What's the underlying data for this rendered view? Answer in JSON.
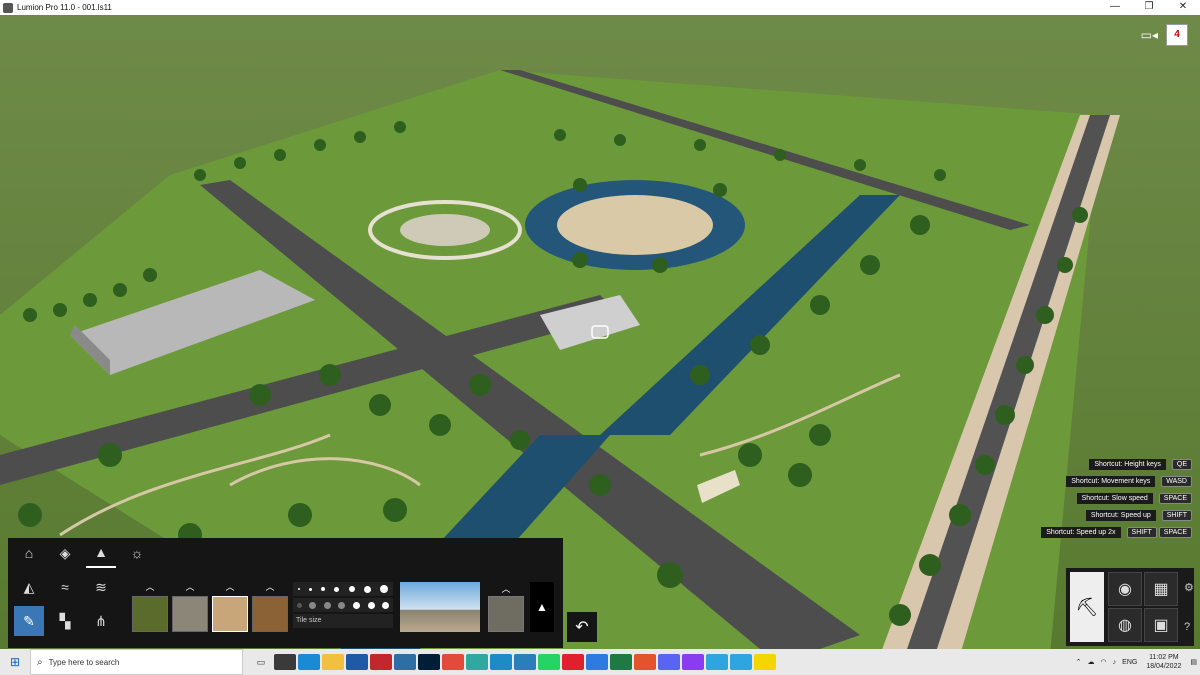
{
  "window": {
    "title": "Lumion Pro 11.0  - 001.ls11",
    "minimize": "—",
    "restore": "❐",
    "close": "✕"
  },
  "viewport": {
    "notification_count": "4",
    "camera_icon": "video-camera-icon"
  },
  "shortcuts": [
    {
      "label": "Shortcut: Height keys",
      "keys": [
        "QE"
      ]
    },
    {
      "label": "Shortcut: Movement keys",
      "keys": [
        "WASD"
      ]
    },
    {
      "label": "Shortcut: Slow speed",
      "keys": [
        "SPACE"
      ]
    },
    {
      "label": "Shortcut: Speed up",
      "keys": [
        "SHIFT"
      ]
    },
    {
      "label": "Shortcut: Speed up 2x",
      "keys": [
        "SHIFT",
        "SPACE"
      ]
    }
  ],
  "landscape_panel": {
    "categories": [
      "home",
      "paint",
      "height",
      "weather",
      "water",
      "ocean",
      "terrain",
      "brush",
      "material",
      "grass"
    ],
    "active_category": "brush",
    "tile_size_label": "Tile size",
    "texture_colors": [
      "#5a6b2c",
      "#8b8677",
      "#c9a57a",
      "#8a6236"
    ]
  },
  "taskbar": {
    "search_placeholder": "Type here to search",
    "tray": {
      "language": "ENG",
      "time": "11:02 PM",
      "date": "18/04/2022"
    }
  }
}
